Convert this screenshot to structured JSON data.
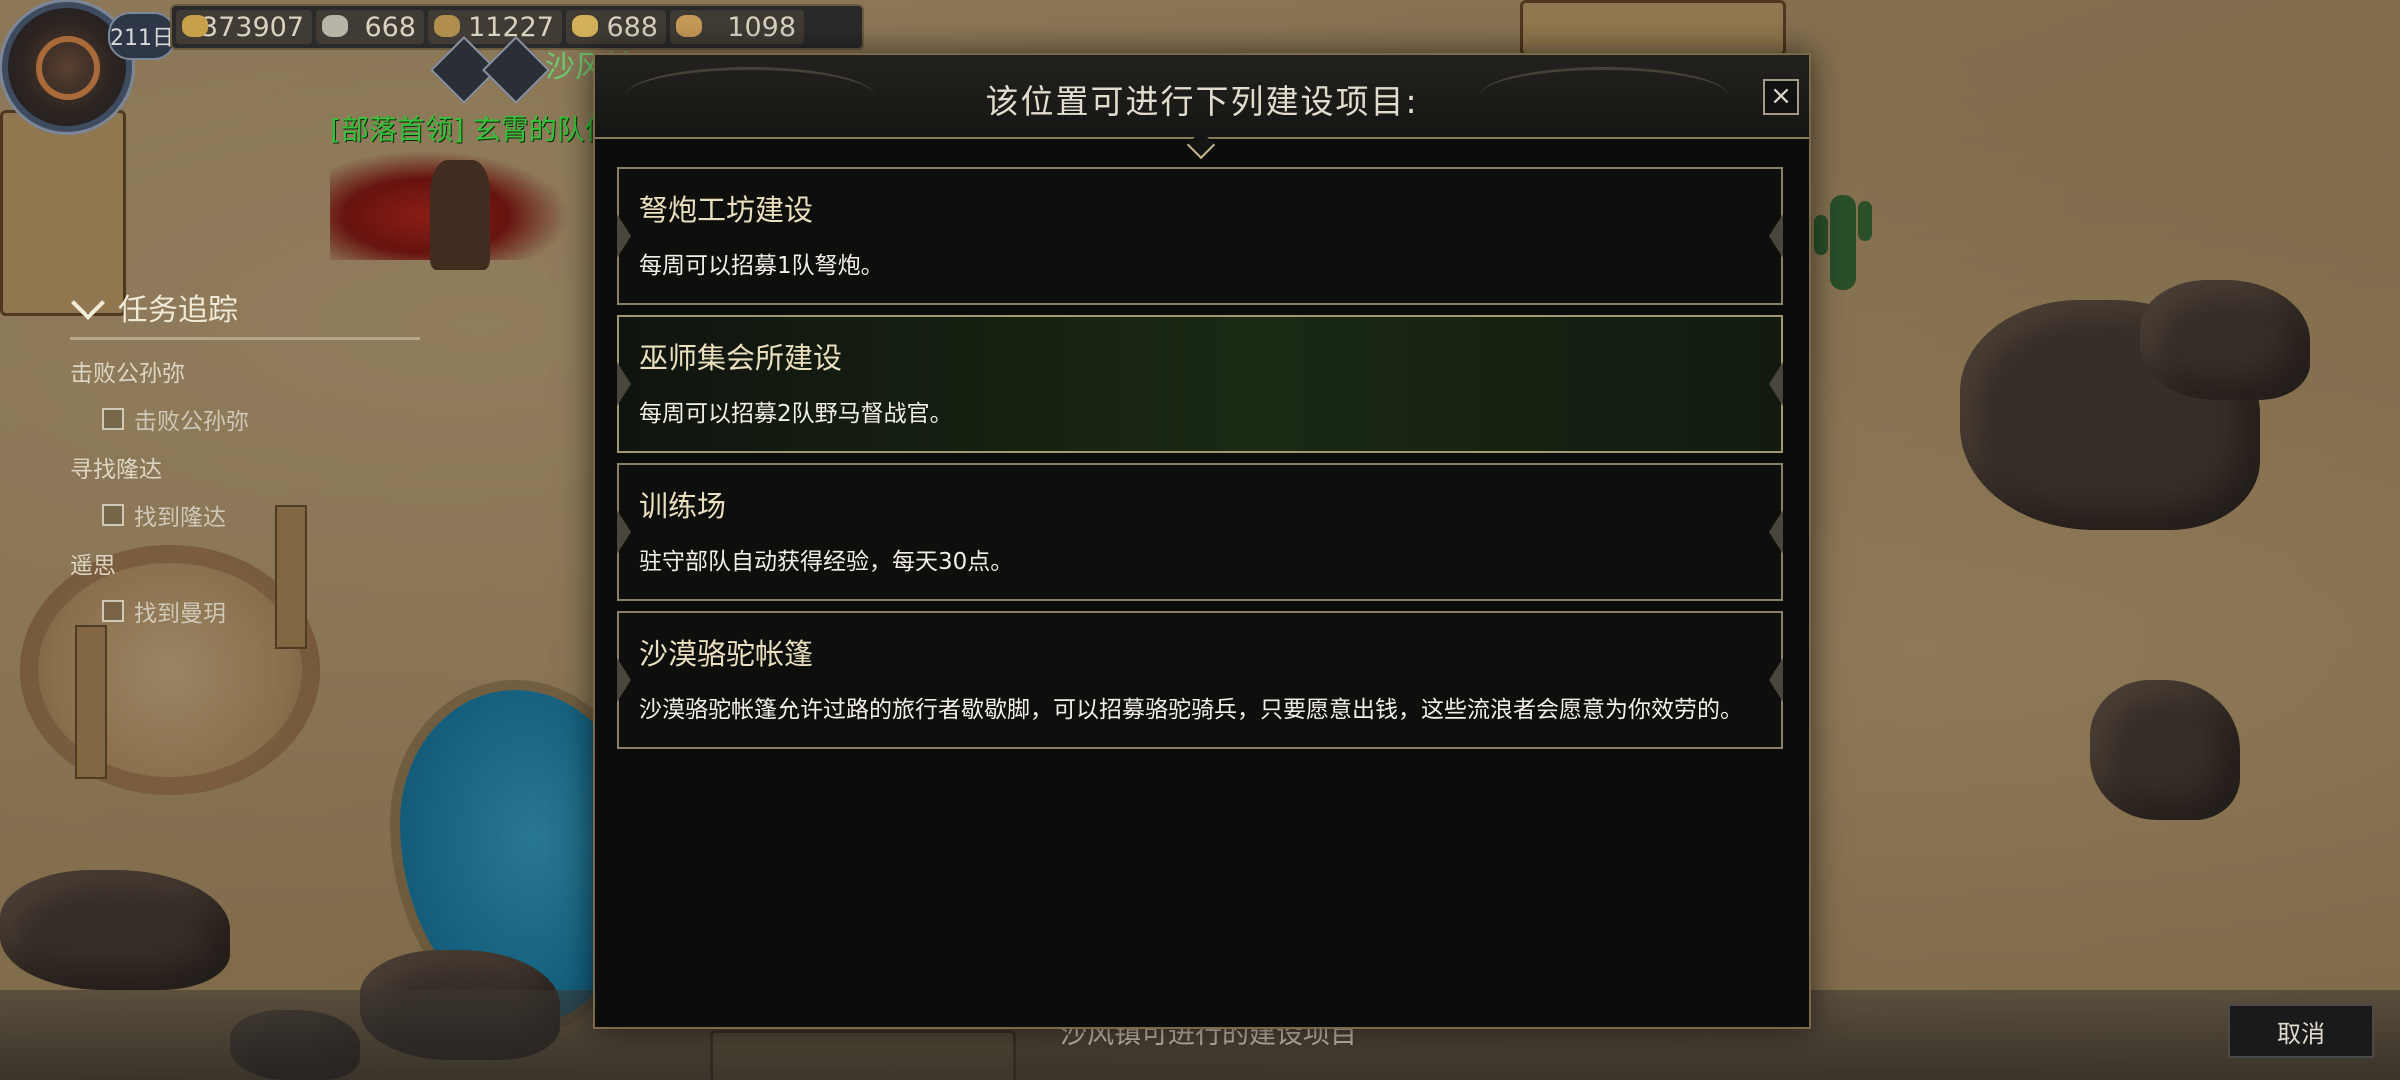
{
  "hud": {
    "day": "211日",
    "resources": [
      {
        "icon": "gold-coin-icon",
        "value": "373907"
      },
      {
        "icon": "silver-ore-icon",
        "value": "668"
      },
      {
        "icon": "wood-icon",
        "value": "11227"
      },
      {
        "icon": "crystal-icon",
        "value": "688"
      },
      {
        "icon": "stone-icon",
        "value": "1098"
      }
    ]
  },
  "map": {
    "town_name": "沙风镇",
    "chief_label": "[部落首领] 玄霄的队伍"
  },
  "quest": {
    "title": "任务追踪",
    "entries": [
      {
        "quest": "击败公孙弥",
        "objective": "击败公孙弥"
      },
      {
        "quest": "寻找隆达",
        "objective": "找到隆达"
      },
      {
        "quest": "遥思",
        "objective": "找到曼玥"
      }
    ]
  },
  "dialog": {
    "title": "该位置可进行下列建设项目:",
    "close_label": "×",
    "items": [
      {
        "name": "弩炮工坊建设",
        "desc": "每周可以招募1队弩炮。"
      },
      {
        "name": "巫师集会所建设",
        "desc": "每周可以招募2队野马督战官。"
      },
      {
        "name": "训练场",
        "desc": "驻守部队自动获得经验，每天30点。"
      },
      {
        "name": "沙漠骆驼帐篷",
        "desc": "沙漠骆驼帐篷允许过路的旅行者歇歇脚，可以招募骆驼骑兵，只要愿意出钱，这些流浪者会愿意为你效劳的。"
      }
    ]
  },
  "footer": {
    "title": "沙风镇可进行的建设项目",
    "cancel_label": "取消"
  },
  "colors": {
    "chief_text": "#35c23a",
    "town_text": "#6ec96e",
    "selected_item_bg": "#1a2a14",
    "dialog_bg": "#0c0c0b"
  }
}
